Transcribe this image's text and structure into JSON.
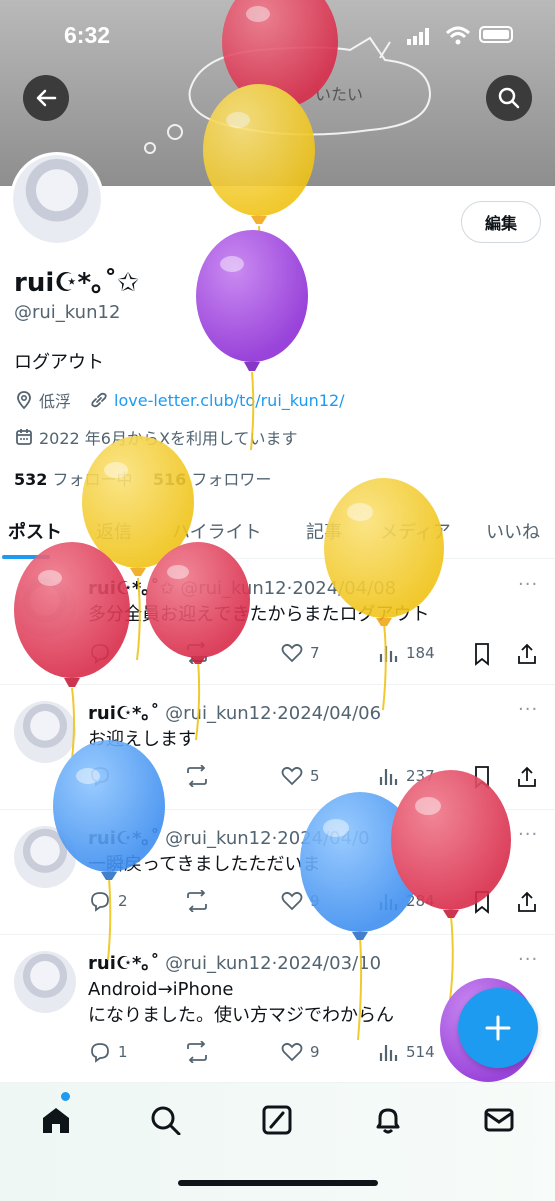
{
  "status_bar": {
    "time": "6:32"
  },
  "profile": {
    "display_name": "rui☪*｡˚✩",
    "handle": "@rui_kun12",
    "bio": "ログアウト",
    "location": "低浮",
    "link": "love-letter.club/to/rui_kun12/",
    "joined": "2022 年6月からXを利用しています",
    "following_count": "532",
    "following_label": "フォロー中",
    "followers_count": "516",
    "followers_label": "フォロワー",
    "edit_label": "編集"
  },
  "tabs": [
    {
      "label": "ポスト"
    },
    {
      "label": "返信"
    },
    {
      "label": "ハイライト"
    },
    {
      "label": "記事"
    },
    {
      "label": "メディア"
    },
    {
      "label": "いいね"
    }
  ],
  "posts": [
    {
      "name": "rui☪*｡˚✩",
      "handle": "@rui_kun12",
      "date": "2024/04/08",
      "text": "多分全員お迎えできたからまたログアウト",
      "replies": "",
      "likes": "7",
      "views": "184"
    },
    {
      "name": "rui☪*｡˚",
      "handle": "@rui_kun12",
      "date": "2024/04/06",
      "text": "お迎えします",
      "replies": "",
      "likes": "5",
      "views": "237"
    },
    {
      "name": "rui☪*｡˚",
      "handle": "@rui_kun12",
      "date": "2024/04/0",
      "text": "一瞬戻ってきましたただいま",
      "replies": "2",
      "likes": "9",
      "views": "284"
    },
    {
      "name": "rui☪*｡˚",
      "handle": "@rui_kun12",
      "date": "2024/03/10",
      "text_line1": "Android→iPhone",
      "text_line2": "になりました。使い方マジでわからん",
      "replies": "1",
      "likes": "9",
      "views": "514"
    }
  ],
  "banner_doodle_text": "いたい",
  "colors": {
    "accent": "#1d9bf0",
    "text": "#0f1419",
    "muted": "#536471"
  },
  "icons": [
    "back-arrow-icon",
    "search-icon",
    "location-pin-icon",
    "link-icon",
    "calendar-icon",
    "reply-icon",
    "repost-icon",
    "like-icon",
    "views-icon",
    "bookmark-icon",
    "share-icon",
    "compose-plus-icon",
    "home-icon",
    "explore-icon",
    "grok-icon",
    "bell-icon",
    "mail-icon"
  ]
}
